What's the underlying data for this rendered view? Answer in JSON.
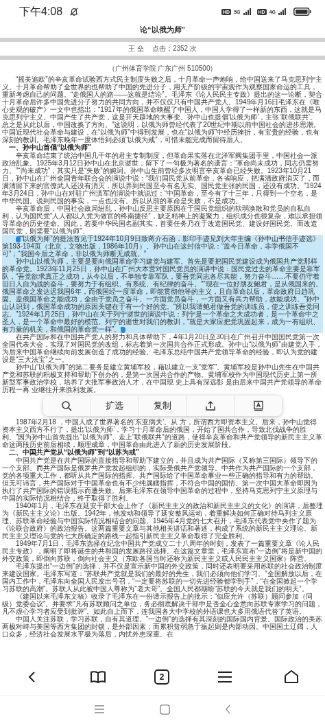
{
  "status_bar": {
    "time": "下午4:08",
    "sims": [
      {
        "badge": "HD",
        "network": "5G"
      },
      {
        "badge": "HD",
        "network": "4G"
      }
    ]
  },
  "article": {
    "title": "论“以俄为师”",
    "author": "王 垒",
    "hits": "点击：2352 次",
    "affiliation": "（广州体育学院 广东广州 510500）",
    "blocks": [
      {
        "kind": "paragraph",
        "selected": false,
        "text": "“摇美追欧”的辛亥革命试验西方式民主制度失败之后，十月革命一声炮响，给中国送来了马克思列宁主义。十月革命帮助了全世界的也帮助了中国的先进分子，用无产阶级的宇宙观作为观察国家命运的工具，重新考虑自己的问题。“走俄国人的路——这就是结论”。毛泽东《论人民民主专政》提出的这一论断，契合十月革命后许多中国先进分子努力的共同方向，并不仅仅只有中国共产党人。1949年月16日毛泽东在《唯心史观的破产》一文中也指出：“1917年的俄国革命唤醒了中国人，中国人学得了一样新的东西，这就是马克思列宁主义。中国产生了共产党，这是开天辟地的大事变。孙中山也提倡‘以俄为师’，主张‘联俄联共’。总之是从此以后，中国改换了方向。”这说明，以俄为师曾经代表了20世纪中期以前中国社会的进步思潮。中国近现代社会革命与建设，在“以俄为师”中得到发展，也在“以俄为师”中经历挫折，有宝贵的经验，也有深刻的教训。毛泽东晚年一度体悟到必须“以俄为戒”，可惜未能完成而留待后人。"
      },
      {
        "kind": "heading",
        "text": "一、孙中山首倡“以俄为师”"
      },
      {
        "kind": "paragraph",
        "selected": false,
        "text": "辛亥革命结束了统治中国几千年的君主专制制度，但革命果实落在北洋军阀集团手里，中国社会一派政治乱象。1925年3月12日孙中山在北京逝世，留下了一句极为著名的遗言：“革命尚未成功，同志仍需努力。”“尚未成功”，其实只是“失败”的婉词。孙中山生前曾经多次明言辛亥革命已经失败。1923年10月21日，孙中山在广州全国青年联合会的演说中说：“我们国民党从前革命，各省响应，把满清政府消灭了，而满清留下来的官僚武人还没有消灭，所以弄到民国至今有名无实。国民党主张的民国，还没有成功。”1924年3月24日，孙中山在对驻广州滇军的演说中就说过：“中国革命，至今有了十三年，只得到一个空名，是中华民国。说到民国的事实，一点也没有。所以从前的革命是失败，不是成功。”"
      },
      {
        "kind": "paragraph",
        "selected": false,
        "text": "辛亥革命后，中国社会政局纷乱，孙中山反思主要原因在于国民党组织的软弱涣散和党员的自私自利，认为国民党“人人都以入党为做官的终南捷径”，缺乏精神上的凝聚力，组织成分也很复杂，难以承担领导革命的历史使命。因此，若要中华民国名副其实，首要任务乃在于改造国民党、建设好国民党。而改造国民党，则需要“以俄为师”。"
      },
      {
        "kind": "paragraph",
        "selected": true,
        "text": "“以俄为师”的提法首见于1924年10月9日致蒋介石函，影印手迹见刘大年主编《孙中山书信手迹选》第193-194页（北京，文物出版，1986年10月）。孙中山在这封信中说：“盖今日革命，非学俄国不可”；“我国今后之革命，非以俄为师断无成就。”"
      },
      {
        "kind": "paragraph",
        "selected": true,
        "text": "孙中山以俄为师，主要是要向俄国革命学习建党与建军。首先是要把国民党建设成为俄国共产党那样的革命党。1923年11月25日，孙中山在广州大本营对国民党员的演讲中说：国民党过去的革命主要是靠军队，“吾党欲求真正之成功，从今以后，不单独专靠军队，要吾党同志各尽其能，努力奋斗……不要仍守着旧日人自为战的奋斗，要努力于有组织、有系统、有纪律的奋斗。”“现在一位好朋友鲍君，是从俄国来的。俄国革命之发达迟我国6年，而俄国经一度革命，即能贯彻他等的主义，且自革命以后，革命政府日趋巩固。盖俄国革命之能成功，全由于党员之奋斗。一方面党员奋斗，一方面又有兵力帮助，故能成功。”孙中山认识到，俄国革命成功的原因关键在于有一个好的党。“所以我请鲍君做吾党的训练员，使之训练吾党同志。”1924年1月25日，孙中山在关于列宁逝世的演说中说：列宁是一个革命之大成功者，是一个革命中之圣人，是一个革命中最好的模范。列宁的逝世对我们的教训，“就是大家应把党巩固起来，成为一有组织、有力量的机关，和俄国的革命党一样”。"
      },
      {
        "kind": "paragraph",
        "selected": false,
        "text": "在共产国际和在中国共产党人的努力和具体帮助下，4年1月20日至30日在广州召开中国国民党第一次全国代表大会，实现了对国民党的改组，标志着第一次国共合作正式形成。孙中山“以俄为师”由建党入手，为后来中国革命继续向前发展创造了成功的经验。毛泽东总结中国共产党领导革命的经验，即认为党的建设是“三大法宝”之一。"
      },
      {
        "kind": "paragraph",
        "selected": false,
        "text": "孙中山“以俄为师”的第二要务是建立黄埔军校，藉以建立一支“党军”。黄埔军校是孙中山先生在中国共产党和苏联的积极支持和帮助下创办的，是第一次国共合作的产物。黄埔军校作为中国现代历史上第一所新型军事政治学校，培养了大批军事政治人才，在中国现 史上具有深远影 是由后来中国共产党领导的革命历程一再 业继往开来胜利发展。"
      },
      {
        "kind": "selection_menu",
        "items": [
          {
            "kind": "search"
          },
          {
            "kind": "text",
            "label": "扩选"
          },
          {
            "kind": "text",
            "label": "复制"
          },
          {
            "kind": "share"
          },
          {
            "kind": "translate"
          }
        ]
      },
      {
        "kind": "paragraph",
        "selected": false,
        "text": "1987年2月18 ，中国人成了世界著名的‘东亚病夫’。从 方，所谓西方即资本主义。后来，孙中山觉得资本主义西方不行了，提出‘以俄为师’，学习十月革命后的俄国，开始了国共合作，导致北伐战争的胜利。”因为孙中山首先提出“以俄为师”、走上“联俄联共”的道路，使得辛亥革命和共产党领导的新民主主义革命这两段历史前后相续，顺理成章，中国革命由此进入了新的历史发展阶段。"
      },
      {
        "kind": "heading",
        "text": "二、中国共产党从“以俄为师”到“以苏为戒”"
      },
      {
        "kind": "paragraph",
        "selected": false,
        "text": "中国共产党是在共产国际的直接指导和帮助下建立的，并且成为共产国际（又称第三国际）领导下的一个支部。而共产国际是俄罗共产党发起组织的，实际受俄共产党领导。中共作为共产国际的一个支部，党的各项重大工作，都听从共产国际的指挥。共产国际给了中国革命事业一些正确的指导和有力的帮助。但无可讳言，共产国际对于中国革命也有不少纯属瞎指挥，不符合中国的国情。第一次中国大革命即因为执行了共产国际的错误指示而遭失败。后来毛泽东在领导中国革命的过程中，坚持马克思列宁主义原理与中国的实际情况相结合，终于取得了胜利。"
      },
      {
        "kind": "paragraph",
        "selected": false,
        "text": "1940年1月，毛泽东在延安干部大会上作了《新民主主义的政治和新民主主义的文化》的演讲，后整理为《新民主主义论》出版。1942年，他发动和领导了延安整风运动，着重解决如何正确对待马列主义原理、苏联革命经验与中国实际情况相结合的问题。1945年4月党的七大召开，毛泽东代表党中央作了题为《论联合政府》的政治报告。这两篇重要文章与其他相关讲话和著述，构成了系统的新民主主义理论。新民主主义理论与党的七大所确定的路线一起指引新民主主义革命取得了完全胜利。"
      },
      {
        "kind": "paragraph",
        "selected": false,
        "text": "1949年7月1日，毛泽东选择在纪念中国共产党成立二十八周年的时刻，发表了一篇重要文章《论人民民主专政》，阐明了即将诞生的共和国的发展路径选择。在这篇文章里，毛泽东宣布“一边倒”将是新中国的外交政策，即倒向苏联，倒向社会主义（东欧各国当时还称为新民主主义或人民民主主义国家）阵营。"
      },
      {
        "kind": "paragraph",
        "selected": false,
        "text": "毛泽东提出“一边倒”的选择，并不仅是宣示新中国的外交政策，同时还表明要采用苏联的社会政治制度来建设国家。毛泽东写道：“苏联共产党就是我们的最好的先生，我们必须向他们学习。”全国解放以后，在国内工作中，毛泽东向全国人民发出号召，“一定要将苏联的一切先进经验都学到手”，“在全国掀起一个学习苏联的高潮”。苏联人从此被中国人尊称为“老大哥”。全国人民都期盼“苏联的今天就是我们的明天”。"
      },
      {
        "kind": "paragraph",
        "selected": false,
        "text": "《建国以来毛泽东文稿》收录了毛泽东在一份请示报告上的批示：“似应允许（苏联）顾问参加（同级）党委会议”。并要求“凡有苏联顾问之单位，务必彻底解决干部中是否全心全意向苏联专家学习的问题，凡不虚心学习者应受到批评”。如此自上而下，连我国各大中学校的外语课也大多用俄语代替了英语。"
      },
      {
        "kind": "paragraph",
        "selected": false,
        "text": "中国人关注苏联，学习苏联，自有其道理。“一边倒”的选择有其深刻的国际国内背景。国际政治的美苏两极对峙与美国等西方集团的封锁，是外部因素；而累积贫弱急于振起则是内部动因。中国国土辽阔，人口众多，经济社会发展水平极为落后，内忧外患深重。在"
      }
    ]
  },
  "toolbar": {
    "tab_count": "2"
  }
}
